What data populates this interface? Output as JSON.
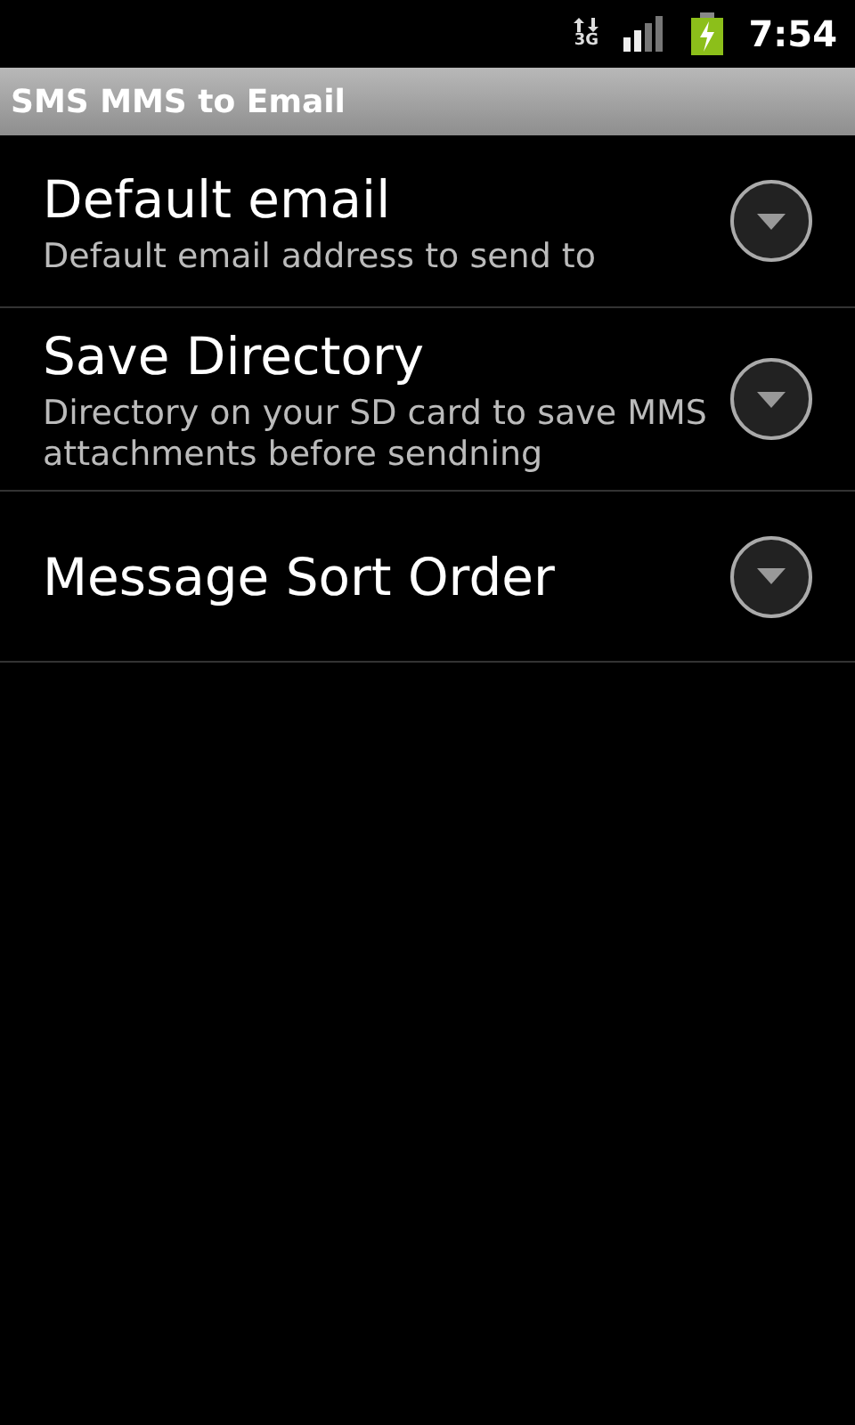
{
  "status_bar": {
    "network": "3G",
    "time": "7:54"
  },
  "title_bar": {
    "title": "SMS MMS to Email"
  },
  "preferences": [
    {
      "title": "Default email",
      "summary": "Default email address to send to"
    },
    {
      "title": "Save Directory",
      "summary": "Directory on your SD card to save MMS attachments before sendning"
    },
    {
      "title": "Message Sort Order"
    }
  ]
}
